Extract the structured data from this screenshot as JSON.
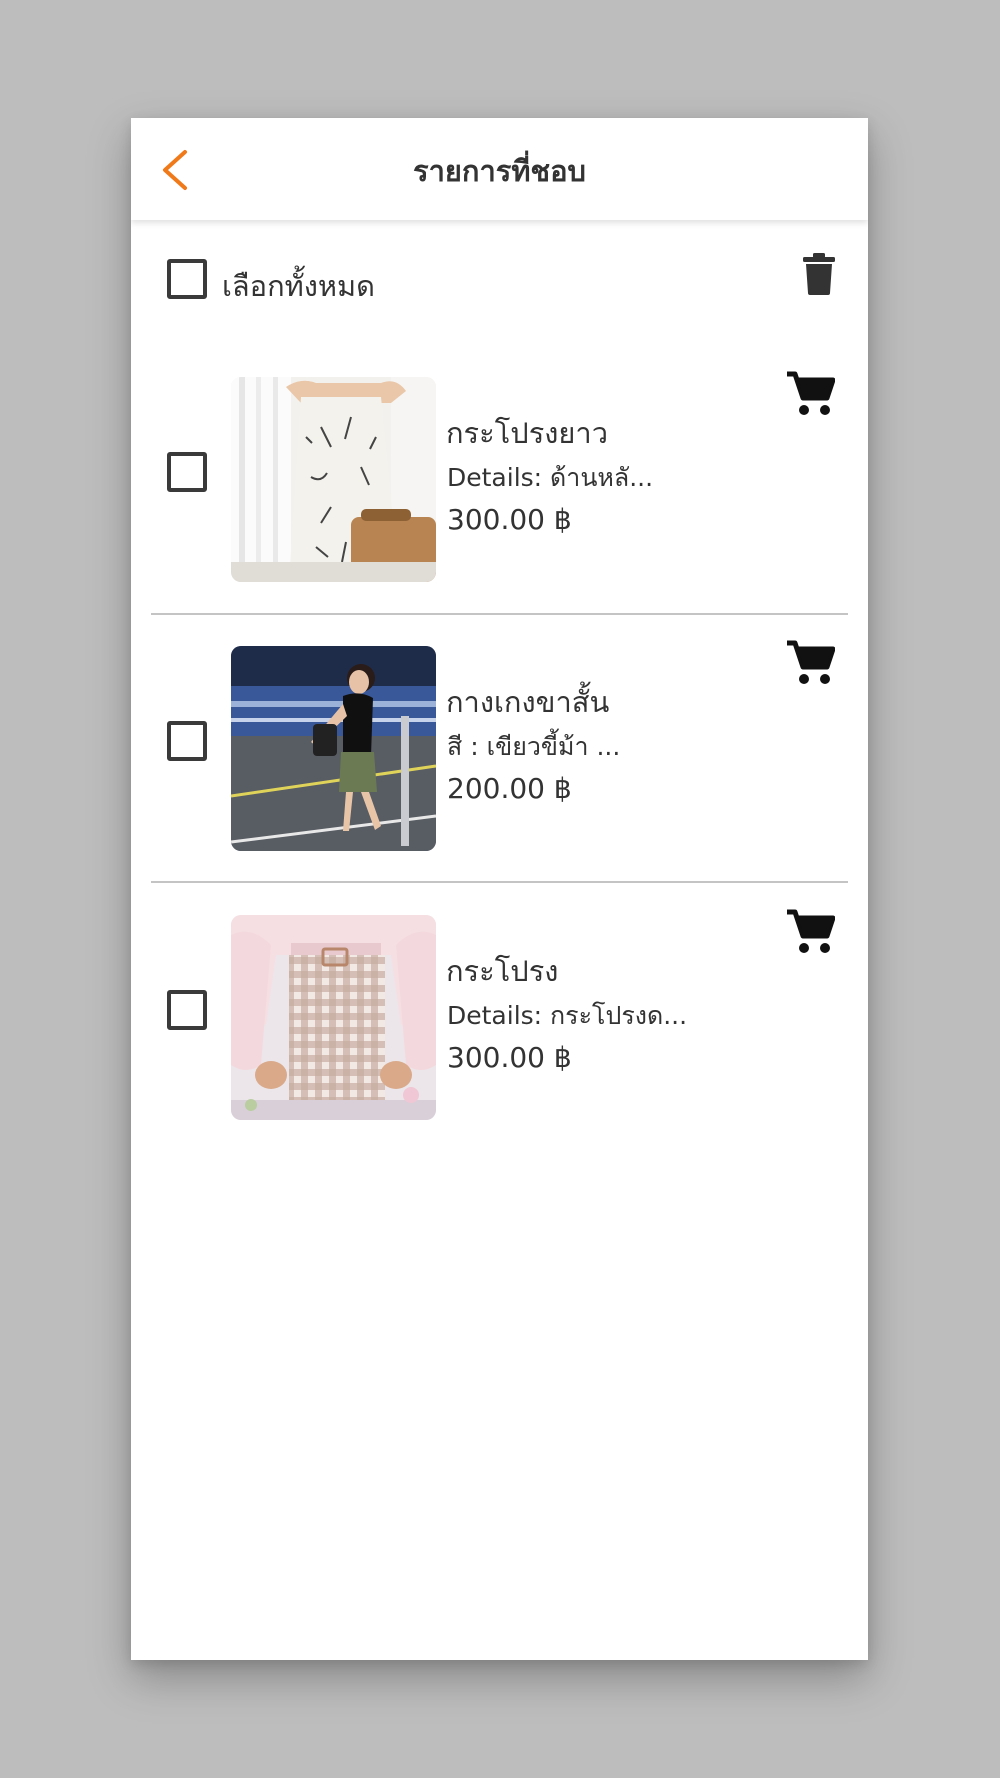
{
  "header": {
    "title": "รายการที่ชอบ",
    "accent_color": "#f07a1a"
  },
  "toolbar": {
    "select_all_label": "เลือกทั้งหมด"
  },
  "items": [
    {
      "name": "กระโปรงยาว",
      "detail": "Details:  ด้านหลั...",
      "price": "300.00 ฿",
      "image": "white-floral-maxi-skirt"
    },
    {
      "name": "กางเกงขาสั้น",
      "detail": "สี : เขียวขี้ม้า ...",
      "price": "200.00 ฿",
      "image": "woman-green-shorts-street"
    },
    {
      "name": "กระโปรง",
      "detail": "Details: กระโปรงด...",
      "price": "300.00 ฿",
      "image": "gingham-mini-skirt"
    }
  ]
}
